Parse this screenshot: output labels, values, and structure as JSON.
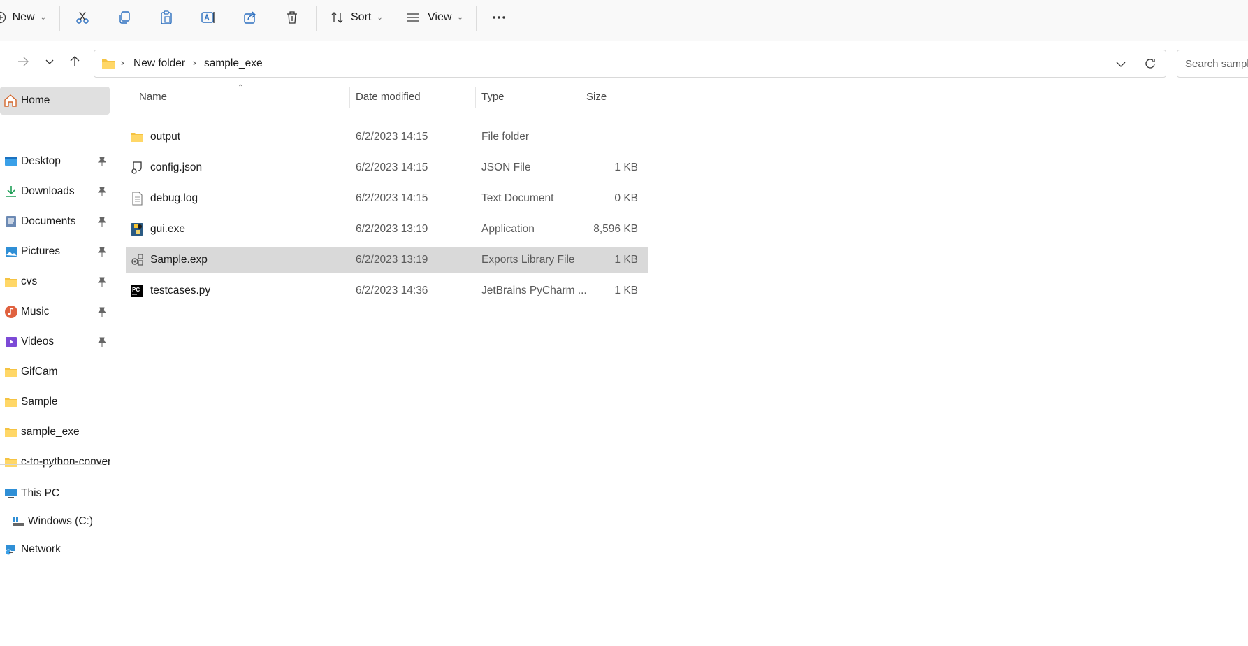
{
  "toolbar": {
    "new_label": "New",
    "sort_label": "Sort",
    "view_label": "View",
    "more_label": "···"
  },
  "address": {
    "crumbs": [
      "New folder",
      "sample_exe"
    ],
    "search_placeholder": "Search sample_exe"
  },
  "sidebar": {
    "home": "Home",
    "quick_access": [
      {
        "label": "Desktop",
        "icon": "desktop-icon",
        "pinned": true
      },
      {
        "label": "Downloads",
        "icon": "download-icon",
        "pinned": true
      },
      {
        "label": "Documents",
        "icon": "documents-icon",
        "pinned": true
      },
      {
        "label": "Pictures",
        "icon": "pictures-icon",
        "pinned": true
      },
      {
        "label": "cvs",
        "icon": "folder-icon",
        "pinned": true
      },
      {
        "label": "Music",
        "icon": "music-icon",
        "pinned": true
      },
      {
        "label": "Videos",
        "icon": "videos-icon",
        "pinned": true
      },
      {
        "label": "GifCam",
        "icon": "folder-icon",
        "pinned": false
      },
      {
        "label": "Sample",
        "icon": "folder-icon",
        "pinned": false
      },
      {
        "label": "sample_exe",
        "icon": "folder-icon",
        "pinned": false
      },
      {
        "label": "c-to-python-conver",
        "icon": "folder-icon",
        "pinned": false
      }
    ],
    "this_pc": "This PC",
    "drive": "Windows (C:)",
    "network": "Network"
  },
  "columns": {
    "name": "Name",
    "date": "Date modified",
    "type": "Type",
    "size": "Size"
  },
  "files": [
    {
      "name": "output",
      "date": "6/2/2023 14:15",
      "type": "File folder",
      "size": "",
      "icon": "folder-icon"
    },
    {
      "name": "config.json",
      "date": "6/2/2023 14:15",
      "type": "JSON File",
      "size": "1 KB",
      "icon": "json-file-icon"
    },
    {
      "name": "debug.log",
      "date": "6/2/2023 14:15",
      "type": "Text Document",
      "size": "0 KB",
      "icon": "text-file-icon"
    },
    {
      "name": "gui.exe",
      "date": "6/2/2023 13:19",
      "type": "Application",
      "size": "8,596 KB",
      "icon": "python-app-icon"
    },
    {
      "name": "Sample.exp",
      "date": "6/2/2023 13:19",
      "type": "Exports Library File",
      "size": "1 KB",
      "icon": "library-file-icon"
    },
    {
      "name": "testcases.py",
      "date": "6/2/2023 14:36",
      "type": "JetBrains PyCharm ...",
      "size": "1 KB",
      "icon": "pycharm-file-icon"
    }
  ],
  "selected_file": "Sample.exp",
  "colors": {
    "folder": "#f5c342",
    "selection": "#d9d9d9",
    "accent": "#0067c0"
  }
}
